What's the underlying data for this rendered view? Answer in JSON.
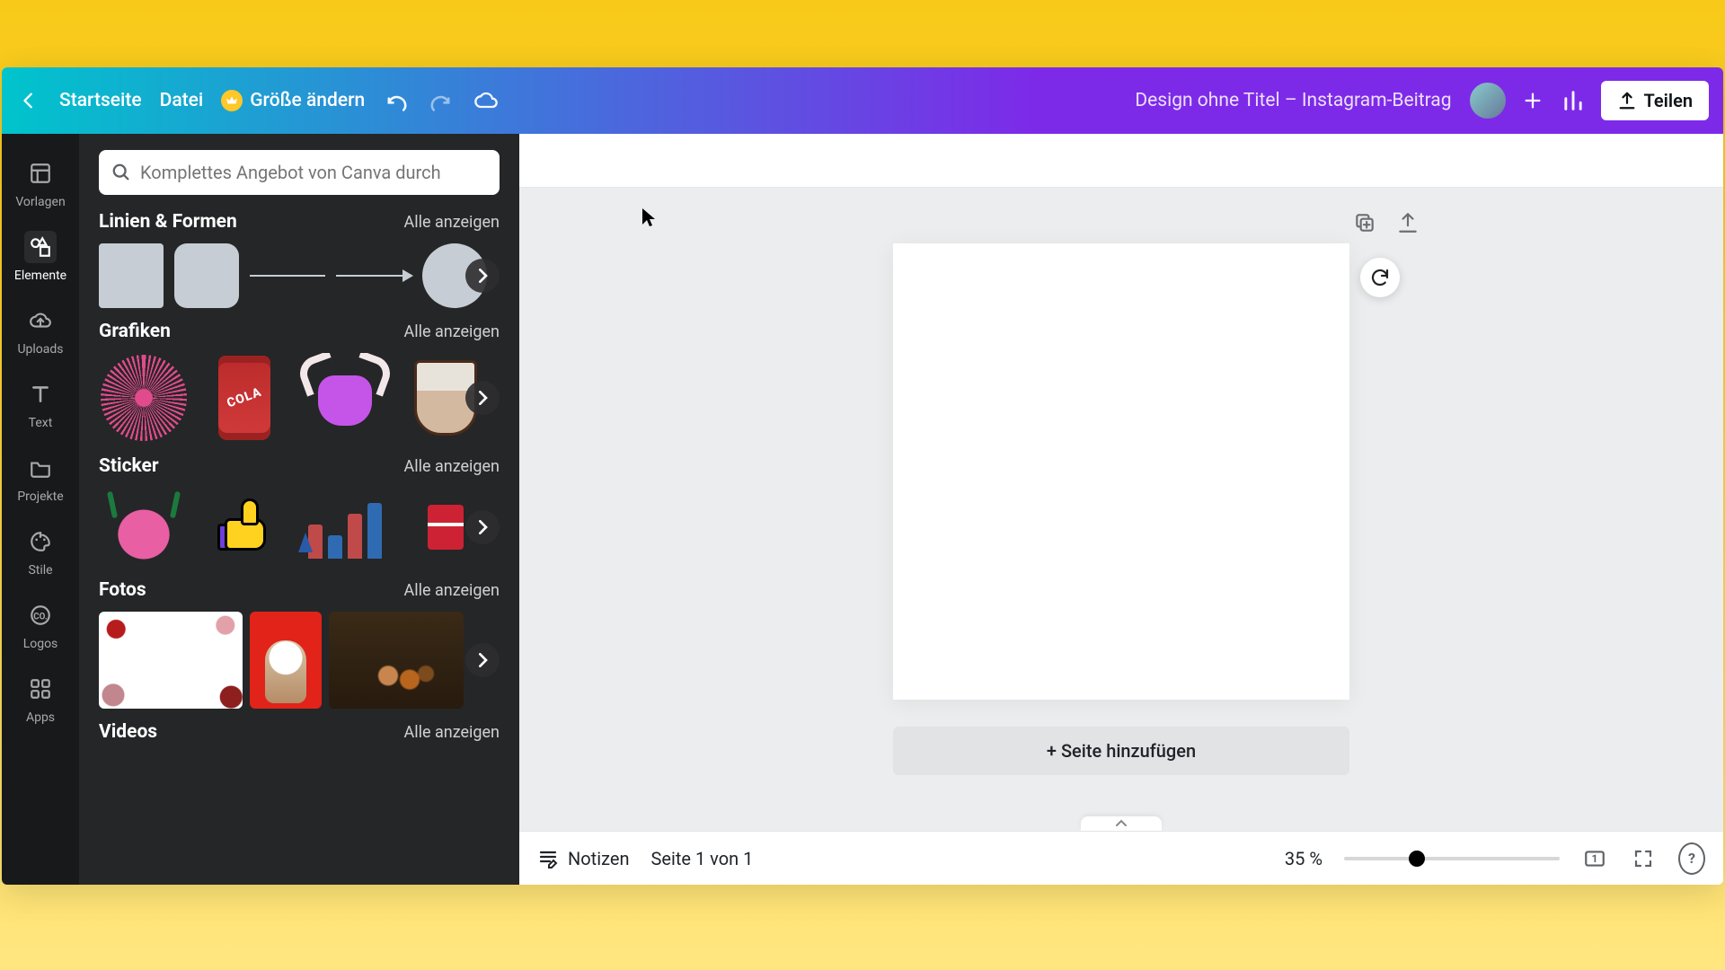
{
  "topbar": {
    "home_label": "Startseite",
    "file_label": "Datei",
    "resize_label": "Größe ändern",
    "doc_title": "Design ohne Titel – Instagram-Beitrag",
    "share_label": "Teilen"
  },
  "rail": {
    "templates": "Vorlagen",
    "elements": "Elemente",
    "uploads": "Uploads",
    "text": "Text",
    "projects": "Projekte",
    "styles": "Stile",
    "logos": "Logos",
    "apps": "Apps"
  },
  "search": {
    "placeholder": "Komplettes Angebot von Canva durch"
  },
  "sections": {
    "lines": {
      "title": "Linien & Formen",
      "link": "Alle anzeigen"
    },
    "graphics": {
      "title": "Grafiken",
      "link": "Alle anzeigen"
    },
    "stickers": {
      "title": "Sticker",
      "link": "Alle anzeigen"
    },
    "photos": {
      "title": "Fotos",
      "link": "Alle anzeigen"
    },
    "videos": {
      "title": "Videos",
      "link": "Alle anzeigen"
    }
  },
  "canvas": {
    "add_page_label": "+ Seite hinzufügen"
  },
  "bottom": {
    "notes_label": "Notizen",
    "page_indicator": "Seite 1 von 1",
    "zoom_label": "35 %",
    "zoom_pct": 35,
    "page_badge": "1",
    "help": "?"
  }
}
